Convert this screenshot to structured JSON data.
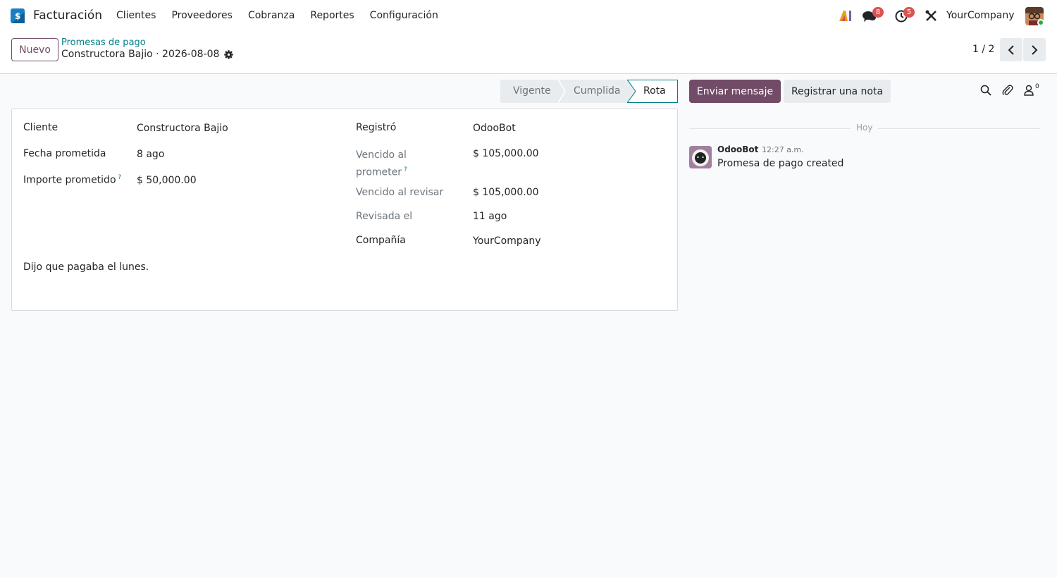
{
  "navbar": {
    "app_name": "Facturación",
    "menu": [
      "Clientes",
      "Proveedores",
      "Cobranza",
      "Reportes",
      "Configuración"
    ],
    "messages_badge": "8",
    "activities_badge": "5",
    "company": "YourCompany"
  },
  "control": {
    "new_button": "Nuevo",
    "breadcrumb_parent": "Promesas de pago",
    "breadcrumb_current": "Constructora Bajio · 2026-08-08",
    "pager": "1 / 2"
  },
  "statusbar": {
    "stages": [
      "Vigente",
      "Cumplida",
      "Rota"
    ],
    "active_stage": "Rota"
  },
  "chatter_buttons": {
    "send_message": "Enviar mensaje",
    "log_note": "Registrar una nota",
    "followers_count": "0"
  },
  "form": {
    "left": {
      "cliente_label": "Cliente",
      "cliente_value": "Constructora Bajio",
      "fecha_label": "Fecha prometida",
      "fecha_value": "8 ago",
      "importe_label": "Importe prometido",
      "importe_help": "?",
      "importe_value": "$ 50,000.00"
    },
    "right": {
      "registro_label": "Registró",
      "registro_value": "OdooBot",
      "vencido_prometer_label_1": "Vencido al",
      "vencido_prometer_label_2": "prometer",
      "vencido_prometer_help": "?",
      "vencido_prometer_value": "$ 105,000.00",
      "vencido_revisar_label": "Vencido al revisar",
      "vencido_revisar_value": "$ 105,000.00",
      "revisada_label": "Revisada el",
      "revisada_value": "11 ago",
      "compania_label": "Compañía",
      "compania_value": "YourCompany"
    },
    "notes": "Dijo que pagaba el lunes."
  },
  "chatter": {
    "day_label": "Hoy",
    "messages": [
      {
        "author": "OdooBot",
        "time": "12:27 a.m.",
        "body": "Promesa de pago created"
      }
    ]
  },
  "colors": {
    "primary": "#714b67",
    "teal": "#017e84",
    "badge_red": "#d9534f"
  }
}
